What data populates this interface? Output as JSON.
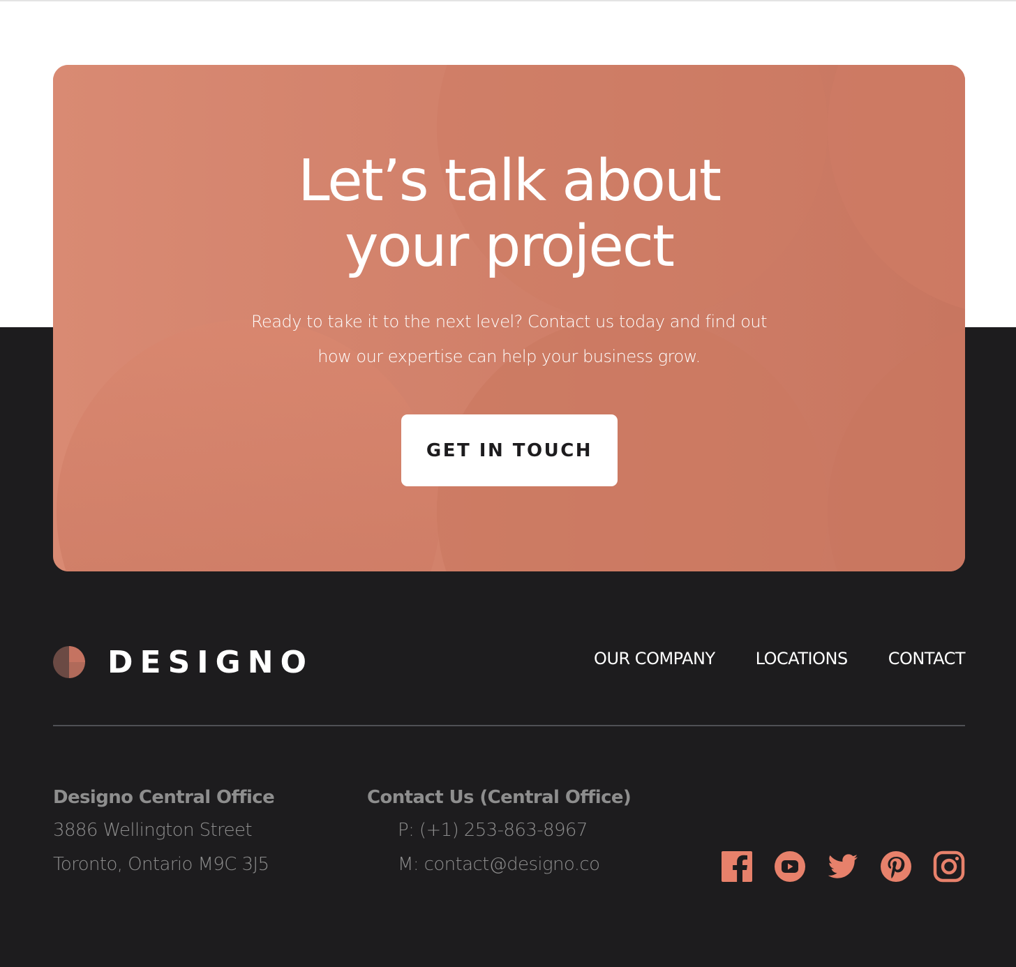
{
  "cta": {
    "title_line1": "Let’s talk about",
    "title_line2": "your project",
    "body": "Ready to take it to the next level? Contact us today and find out how our expertise can help your business grow.",
    "button_label": "GET IN TOUCH"
  },
  "footer": {
    "logo_text": "DESIGNO",
    "nav": [
      "OUR COMPANY",
      "LOCATIONS",
      "CONTACT"
    ],
    "office": {
      "heading": "Designo Central Office",
      "line1": "3886 Wellington Street",
      "line2": "Toronto, Ontario M9C 3J5"
    },
    "contact": {
      "heading": "Contact Us (Central Office)",
      "phone": "P: (+1) 253-863-8967",
      "email": "M: contact@designo.co"
    },
    "socials": [
      "facebook-icon",
      "youtube-icon",
      "twitter-icon",
      "pinterest-icon",
      "instagram-icon"
    ]
  },
  "colors": {
    "accent": "#E7816B",
    "card": "#D6836C",
    "dark": "#1D1C1E",
    "muted_text": "#8E8E8E",
    "white": "#FFFFFF"
  }
}
